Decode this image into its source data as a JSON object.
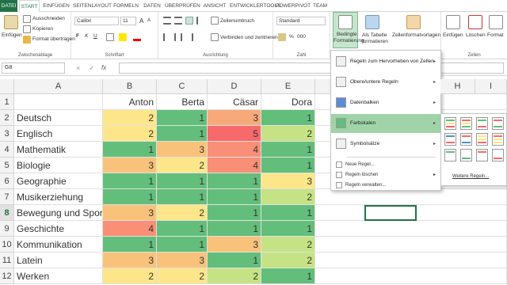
{
  "tabs": [
    "DATEI",
    "START",
    "EINFÜGEN",
    "SEITENLAYOUT",
    "FORMELN",
    "DATEN",
    "ÜBERPRÜFEN",
    "ANSICHT",
    "ENTWICKLERTOOLS",
    "POWERPIVOT",
    "TEAM"
  ],
  "ribbon": {
    "clipboard": {
      "paste": "Einfügen",
      "cut": "Ausschneiden",
      "copy": "Kopieren",
      "format_painter": "Format übertragen",
      "label": "Zwischenablage"
    },
    "font": {
      "name": "Calibri",
      "size": "11",
      "bold": "F",
      "italic": "K",
      "underline": "U",
      "grow": "A",
      "shrink": "A",
      "label": "Schriftart"
    },
    "alignment": {
      "wrap": "Zeilenumbruch",
      "merge": "Verbinden und zentrieren",
      "label": "Ausrichtung"
    },
    "number": {
      "format": "Standard",
      "percent": "%",
      "thousands": "000",
      "label": "Zahl"
    },
    "styles": {
      "conditional": "Bedingte",
      "conditional2": "Formatierung",
      "table": "Als Tabelle",
      "table2": "formatieren",
      "cellstyles": "Zellenformatvorlagen"
    },
    "cells": {
      "insert": "Einfügen",
      "delete": "Löschen",
      "format": "Format",
      "label": "Zellen"
    }
  },
  "namebox": "G8",
  "formula_icons": {
    "cancel": "×",
    "enter": "✓",
    "fx": "fx"
  },
  "columns": [
    "A",
    "B",
    "C",
    "D",
    "E"
  ],
  "extra_columns": [
    "H",
    "I"
  ],
  "rows": [
    {
      "num": "1",
      "label": "",
      "values": [
        "Anton",
        "Berta",
        "Cäsar",
        "Dora"
      ],
      "colors": [
        "#ffffff",
        "#ffffff",
        "#ffffff",
        "#ffffff"
      ]
    },
    {
      "num": "2",
      "label": "Deutsch",
      "values": [
        "2",
        "1",
        "3",
        "1"
      ],
      "colors": [
        "#fde68a",
        "#63be7b",
        "#f8a97a",
        "#63be7b"
      ]
    },
    {
      "num": "3",
      "label": "Englisch",
      "values": [
        "2",
        "1",
        "5",
        "2"
      ],
      "colors": [
        "#fde68a",
        "#63be7b",
        "#f8696b",
        "#c5e384"
      ]
    },
    {
      "num": "4",
      "label": "Mathematik",
      "values": [
        "1",
        "3",
        "4",
        "1"
      ],
      "colors": [
        "#63be7b",
        "#f9c27a",
        "#f88f76",
        "#63be7b"
      ]
    },
    {
      "num": "5",
      "label": "Biologie",
      "values": [
        "3",
        "2",
        "4",
        "1"
      ],
      "colors": [
        "#f9c27a",
        "#fde68a",
        "#f88f76",
        "#63be7b"
      ]
    },
    {
      "num": "6",
      "label": "Geographie",
      "values": [
        "1",
        "1",
        "1",
        "3"
      ],
      "colors": [
        "#63be7b",
        "#63be7b",
        "#63be7b",
        "#fde68a"
      ]
    },
    {
      "num": "7",
      "label": "Musikerziehung",
      "values": [
        "1",
        "1",
        "1",
        "2"
      ],
      "colors": [
        "#63be7b",
        "#63be7b",
        "#63be7b",
        "#c5e384"
      ]
    },
    {
      "num": "8",
      "label": "Bewegung und Sport",
      "values": [
        "3",
        "2",
        "1",
        "1"
      ],
      "colors": [
        "#f9c27a",
        "#fde68a",
        "#63be7b",
        "#63be7b"
      ]
    },
    {
      "num": "9",
      "label": "Geschichte",
      "values": [
        "4",
        "1",
        "1",
        "1"
      ],
      "colors": [
        "#f88f76",
        "#63be7b",
        "#63be7b",
        "#63be7b"
      ]
    },
    {
      "num": "10",
      "label": "Kommunikation",
      "values": [
        "1",
        "1",
        "3",
        "2"
      ],
      "colors": [
        "#63be7b",
        "#63be7b",
        "#f9c27a",
        "#c5e384"
      ]
    },
    {
      "num": "11",
      "label": "Latein",
      "values": [
        "3",
        "3",
        "1",
        "2"
      ],
      "colors": [
        "#f9c27a",
        "#f9c27a",
        "#63be7b",
        "#c5e384"
      ]
    },
    {
      "num": "12",
      "label": "Werken",
      "values": [
        "2",
        "2",
        "2",
        "1"
      ],
      "colors": [
        "#fde68a",
        "#fde68a",
        "#c5e384",
        "#63be7b"
      ]
    }
  ],
  "menu": {
    "items": [
      "Regeln zum Hervorheben von Zellen",
      "Obere/untere Regeln",
      "Datenbalken",
      "Farbskalen",
      "Symbolsätze"
    ],
    "small": [
      "Neue Regel...",
      "Regeln löschen",
      "Regeln verwalten..."
    ]
  },
  "submenu": {
    "more": "Weitere Regeln..."
  }
}
